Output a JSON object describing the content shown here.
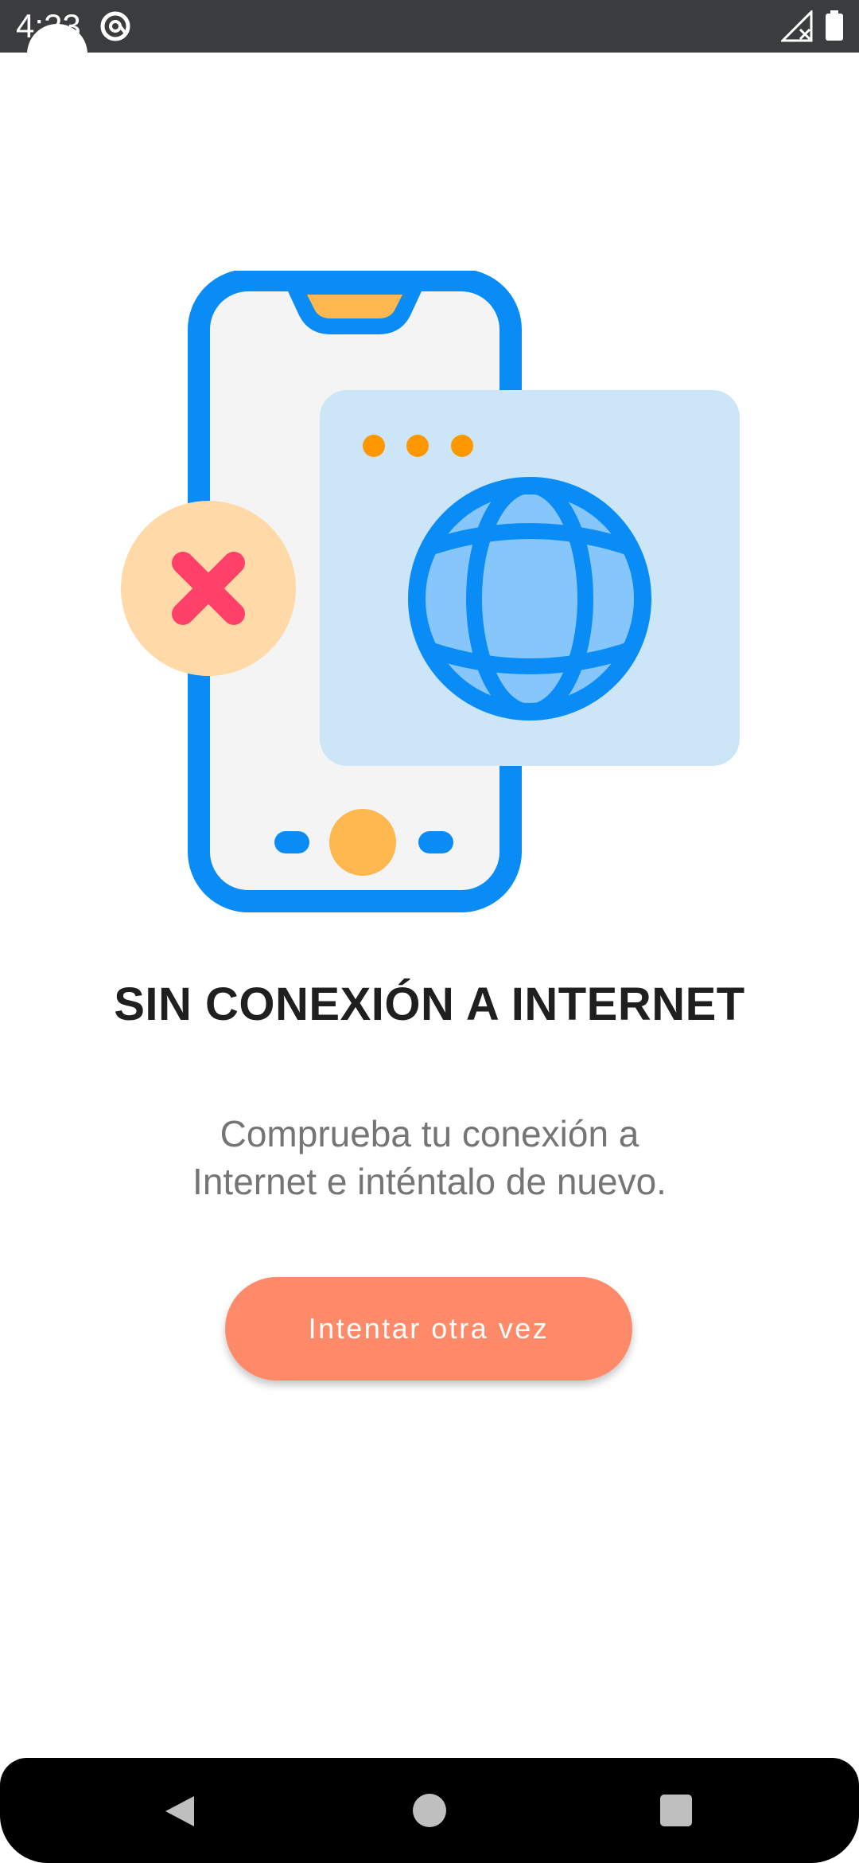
{
  "status_bar": {
    "time": "4:23",
    "icons": [
      "at-sign-icon",
      "signal-no-data-icon",
      "battery-icon"
    ]
  },
  "illustration": {
    "icons": [
      "smartphone-icon",
      "browser-window-icon",
      "globe-icon",
      "error-x-icon"
    ],
    "colors": {
      "phone_frame": "#0a8cf7",
      "phone_screen": "#f4f4f4",
      "notch": "#ffb74f",
      "window_bg": "#cce6f8",
      "window_dots": "#ff9800",
      "globe_fill": "#86c6fb",
      "error_bg": "#ffdaa8",
      "error_x": "#ff4069"
    }
  },
  "main": {
    "title": "SIN CONEXIÓN A INTERNET",
    "subtitle_line1": "Comprueba tu conexión a",
    "subtitle_line2": "Internet e inténtalo de nuevo.",
    "retry_label": "Intentar otra vez"
  },
  "colors": {
    "button": "#ff8a6a",
    "title": "#1f1f1f",
    "subtitle": "#757575"
  },
  "nav_bar": {
    "icons": [
      "back-triangle-icon",
      "home-circle-icon",
      "recents-square-icon"
    ]
  }
}
